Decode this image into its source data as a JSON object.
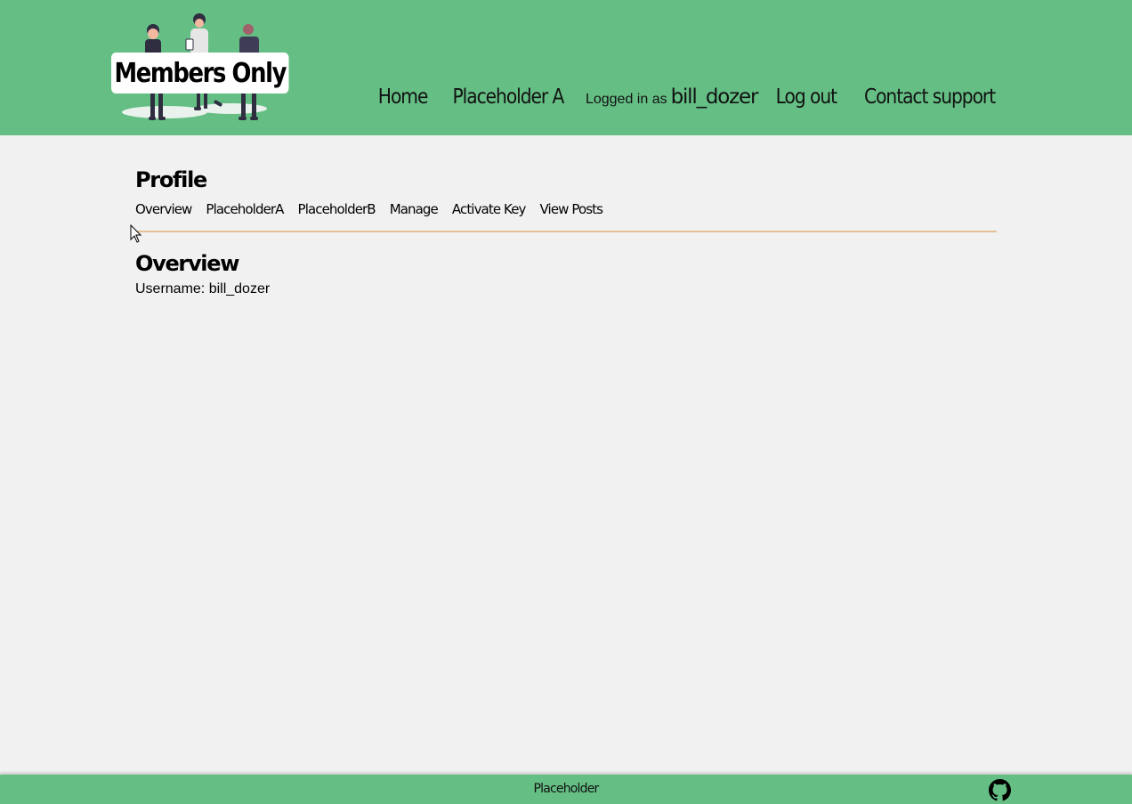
{
  "colors": {
    "header_bg": "#65bf85",
    "page_bg": "#f1f1f1",
    "divider": "#e6c196"
  },
  "header": {
    "logo_text": "Members Only",
    "logo_icon": "people-illustration",
    "nav": {
      "home": "Home",
      "placeholder_a": "Placeholder A",
      "logged_in_prefix": "Logged in as",
      "username": "bill_dozer",
      "logout": "Log out",
      "contact": "Contact support"
    }
  },
  "main": {
    "title": "Profile",
    "tabs": [
      "Overview",
      "PlaceholderA",
      "PlaceholderB",
      "Manage",
      "Activate Key",
      "View Posts"
    ],
    "section_title": "Overview",
    "username_line": "Username: bill_dozer"
  },
  "footer": {
    "text": "Placeholder",
    "icon": "github-icon"
  }
}
